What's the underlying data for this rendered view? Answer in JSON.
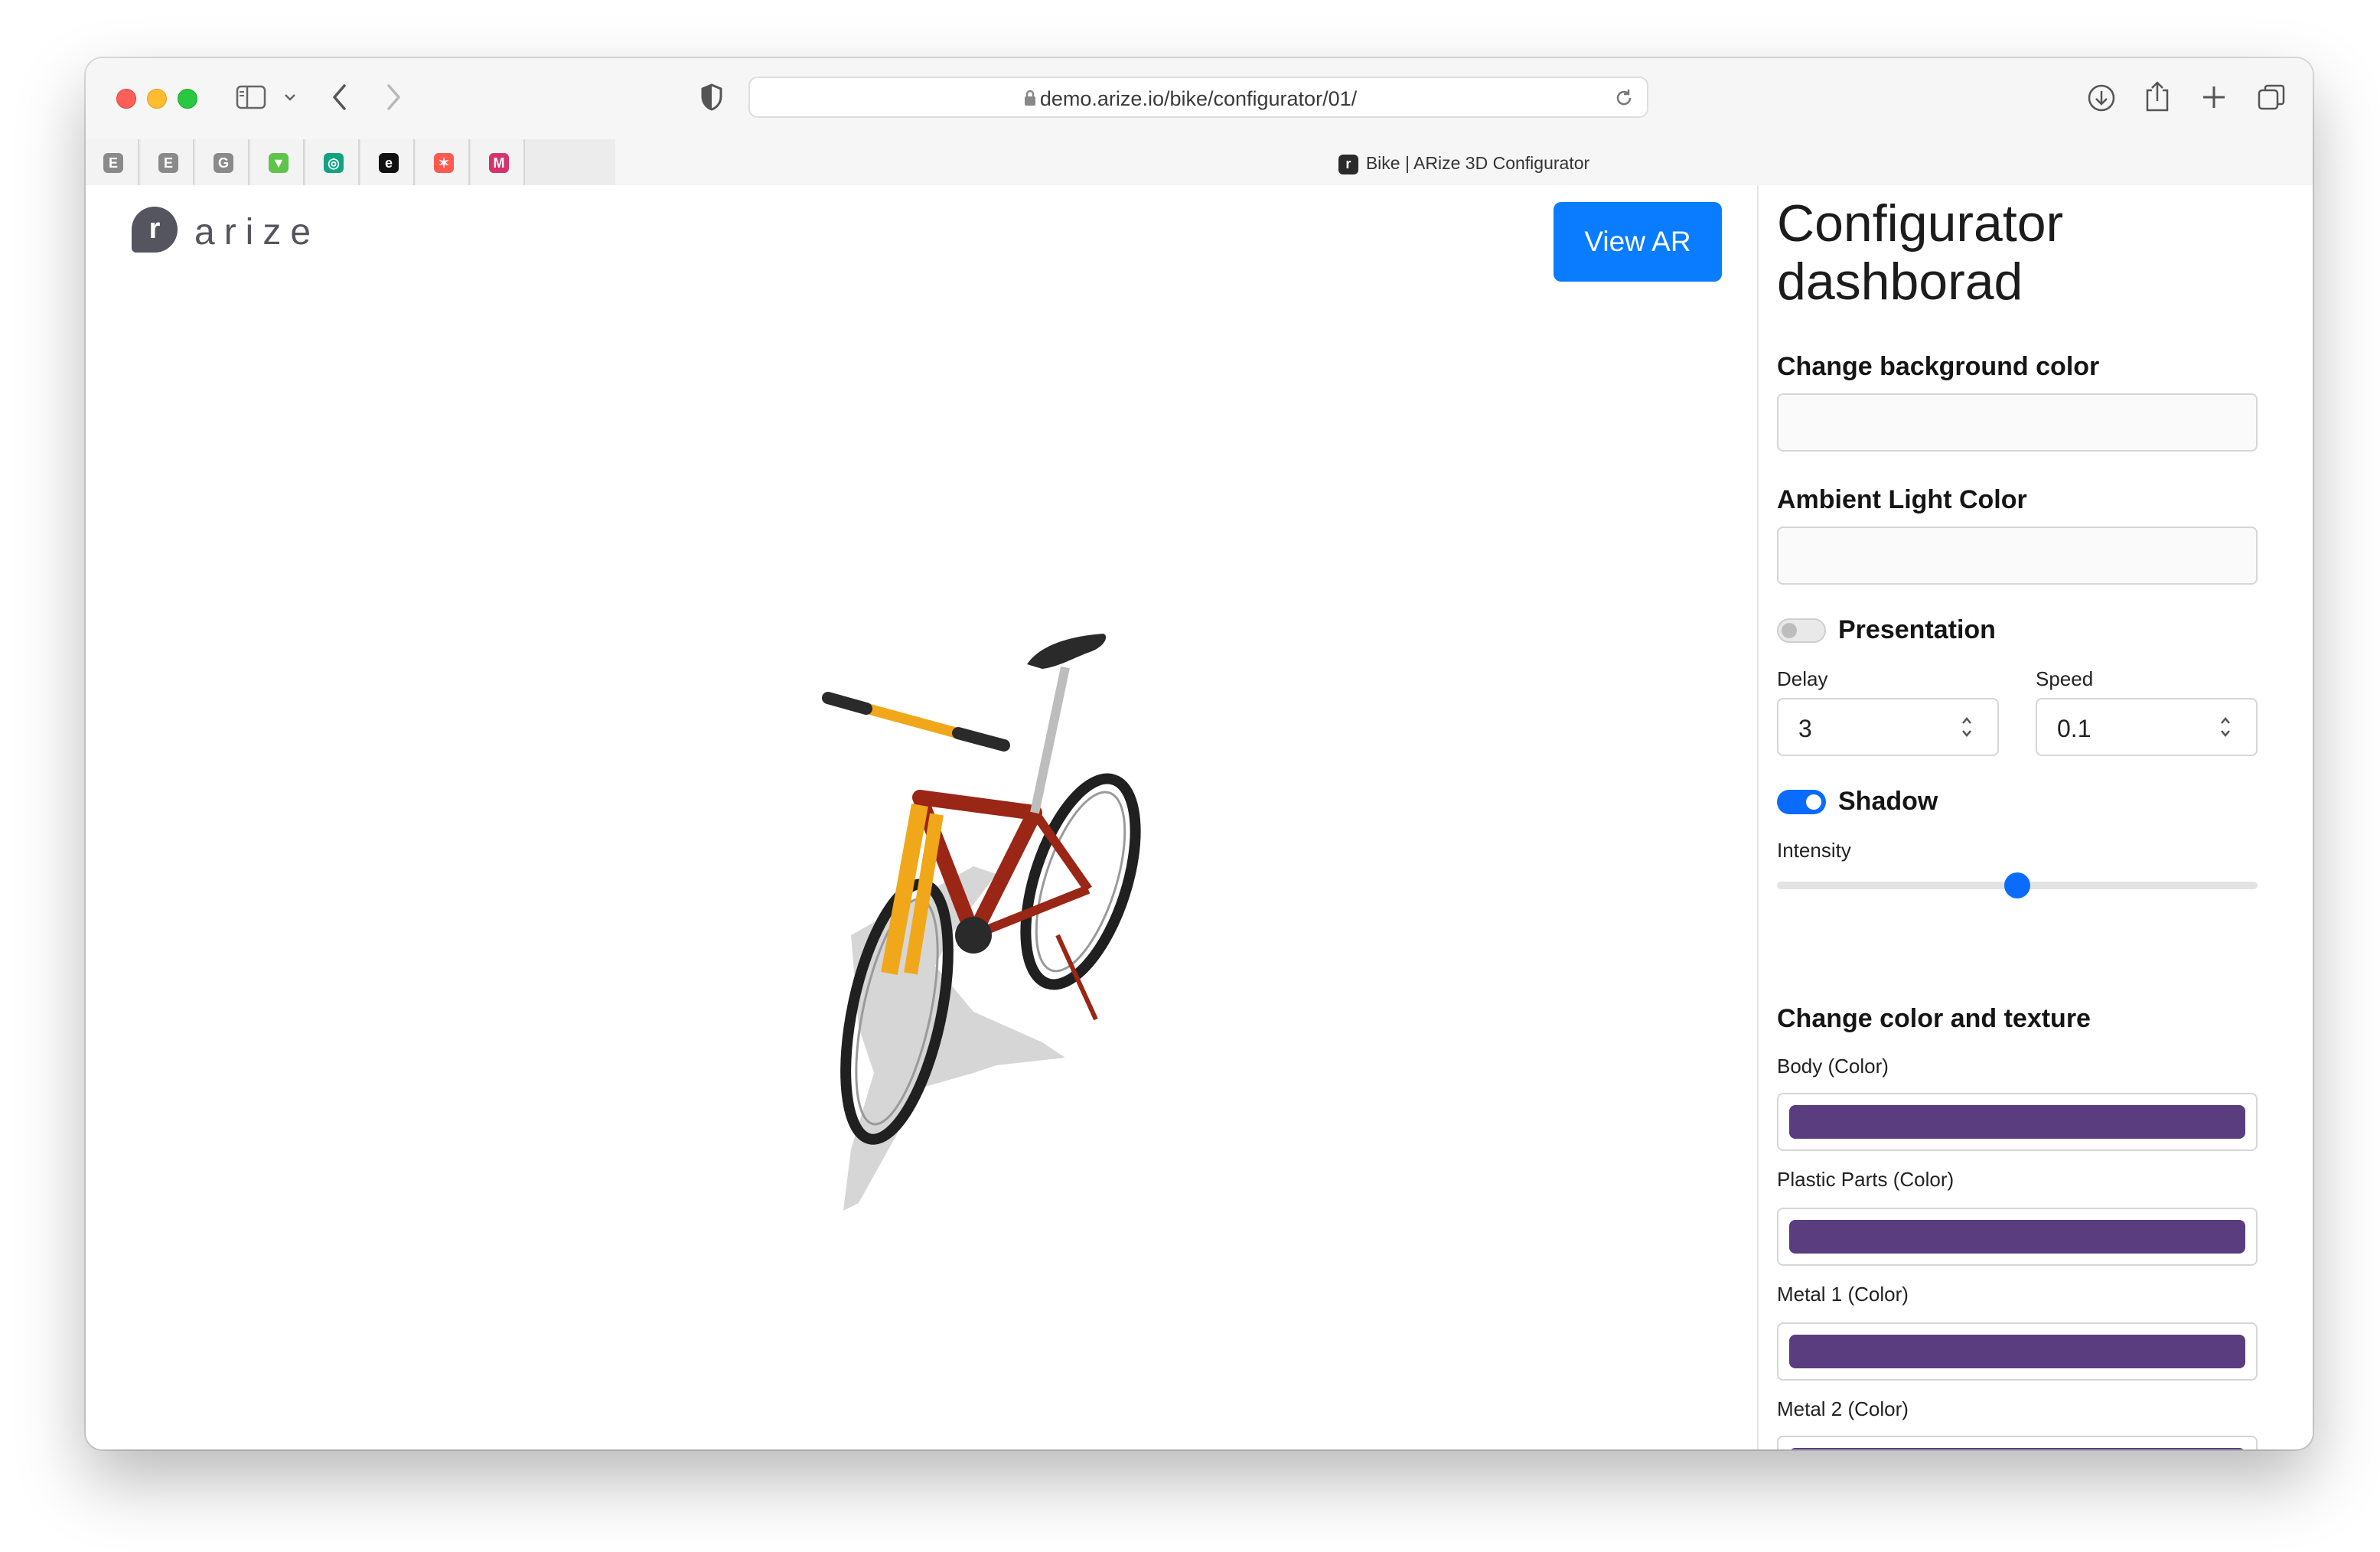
{
  "browser": {
    "url": "demo.arize.io/bike/configurator/01/",
    "tab_title": "Bike | ARize 3D Configurator",
    "pinned_tabs": [
      {
        "glyph": "E",
        "color": "#8a8a8a",
        "icon": "e-favicon"
      },
      {
        "glyph": "E",
        "color": "#8a8a8a",
        "icon": "e-favicon"
      },
      {
        "glyph": "G",
        "color": "#8a8a8a",
        "icon": "g-favicon"
      },
      {
        "glyph": "▼",
        "color": "#5ec44a",
        "icon": "green-v-favicon"
      },
      {
        "glyph": "◎",
        "color": "#10a37f",
        "icon": "chatgpt-favicon"
      },
      {
        "glyph": "e",
        "color": "#111111",
        "icon": "e-black-favicon"
      },
      {
        "glyph": "✶",
        "color": "#ff5a4f",
        "icon": "monday-favicon"
      },
      {
        "glyph": "M",
        "color": "#d6336c",
        "icon": "m-favicon"
      }
    ]
  },
  "header": {
    "logo_mark": "r",
    "logo_text": "arize",
    "view_ar_label": "View AR"
  },
  "panel": {
    "title": "Configurator dashborad",
    "bg_color_heading": "Change background color",
    "ambient_heading": "Ambient Light Color",
    "presentation_label": "Presentation",
    "presentation_on": false,
    "delay_label": "Delay",
    "delay_value": "3",
    "speed_label": "Speed",
    "speed_value": "0.1",
    "shadow_label": "Shadow",
    "shadow_on": true,
    "intensity_label": "Intensity",
    "intensity_value": 0.5,
    "texture_heading": "Change color and texture",
    "colors": [
      {
        "label": "Body (Color)",
        "value": "#5a3d7e"
      },
      {
        "label": "Plastic Parts (Color)",
        "value": "#5a3d7e"
      },
      {
        "label": "Metal 1 (Color)",
        "value": "#5a3d7e"
      },
      {
        "label": "Metal 2 (Color)",
        "value": "#5a3d7e"
      }
    ]
  },
  "accent": "#0a7cff"
}
